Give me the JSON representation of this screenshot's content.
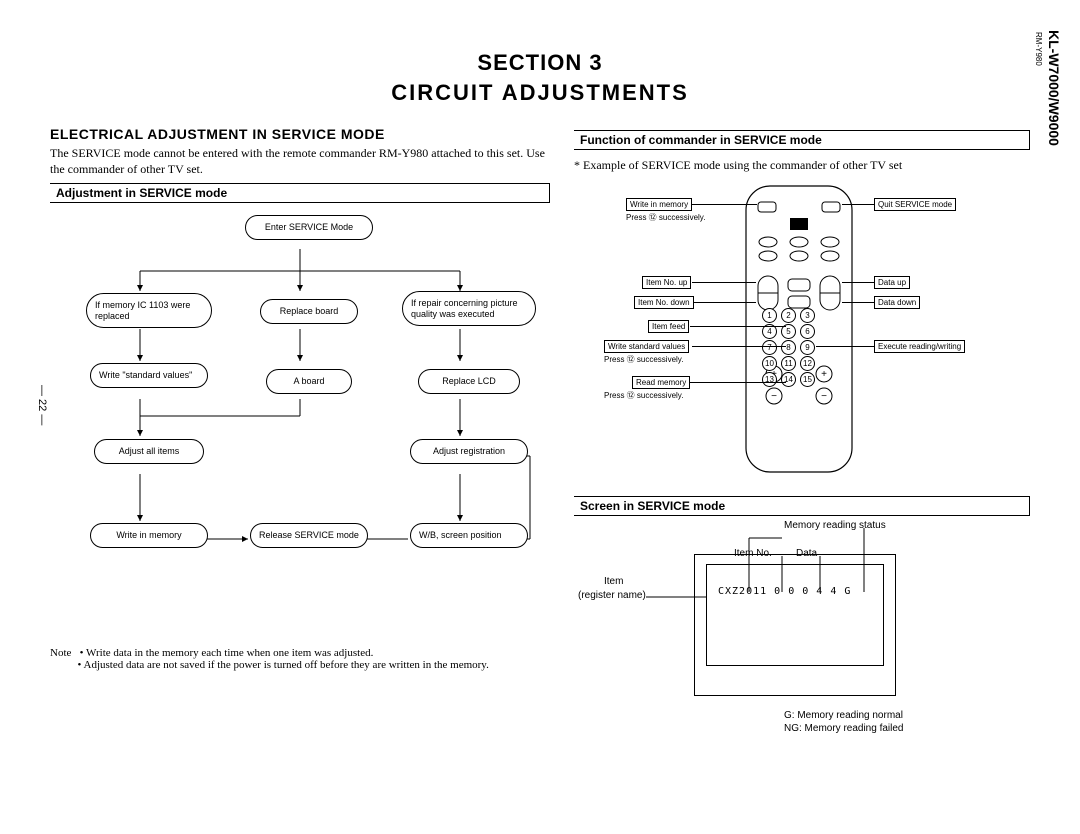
{
  "header": {
    "model": "KL-W7000/W9000",
    "sub_model": "RM-Y980",
    "page_num": "— 22 —",
    "section_line1": "SECTION  3",
    "section_line2": "CIRCUIT  ADJUSTMENTS"
  },
  "left": {
    "title": "ELECTRICAL ADJUSTMENT IN SERVICE MODE",
    "intro": "The SERVICE mode cannot be entered with the remote commander RM-Y980 attached to this set. Use the commander of other TV set.",
    "bar": "Adjustment in SERVICE mode",
    "nodes": {
      "enter": "Enter SERVICE Mode",
      "mem": "If memory IC 1103 were replaced",
      "replace_board": "Replace board",
      "repair": "If repair concerning picture quality was executed",
      "std": "Write \"standard values\"",
      "aboard": "A  board",
      "replace_lcd": "Replace LCD",
      "adjust_all": "Adjust all items",
      "adjust_reg": "Adjust registration",
      "write_mem": "Write in memory",
      "release": "Release SERVICE mode",
      "wb": "W/B, screen position"
    },
    "note_label": "Note",
    "note1": "• Write data in the memory each time when one item was adjusted.",
    "note2": "• Adjusted data are not saved if the power is turned off before they are written in the memory."
  },
  "right": {
    "bar1": "Function of commander in SERVICE mode",
    "example": "* Example of SERVICE mode using the commander of other TV set",
    "callouts": {
      "write_mem": "Write in memory",
      "press12a": "Press ⑫ successively.",
      "item_up": "Item No. up",
      "item_down": "Item No. down",
      "item_feed": "Item feed",
      "write_std": "Write standard values",
      "press12b": "Press ⑫ successively.",
      "read_mem": "Read memory",
      "press12c": "Press ⑫ successively.",
      "quit": "Quit SERVICE mode",
      "data_up": "Data up",
      "data_down": "Data down",
      "exec": "Execute reading/writing"
    },
    "bar2": "Screen in SERVICE mode",
    "screen": {
      "mem_status": "Memory reading status",
      "item_no": "Item No.",
      "data": "Data",
      "item": "Item",
      "regname": "(register name)",
      "line": "CXZ2011   0  0    0 4 4   G",
      "legend1": "G:  Memory reading normal",
      "legend2": "NG:  Memory reading failed"
    }
  }
}
